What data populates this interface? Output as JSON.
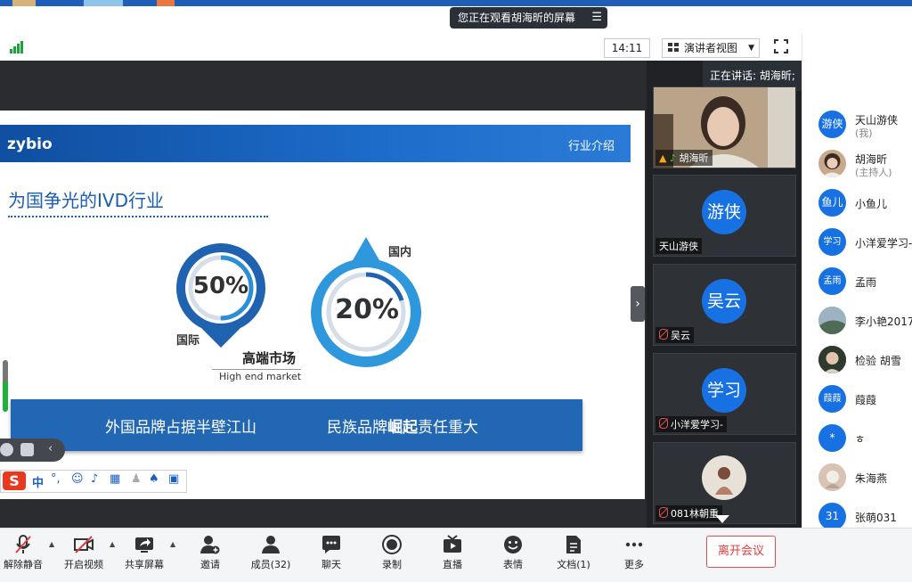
{
  "banner": {
    "watching_text": "您正在观看胡海昕的屏幕"
  },
  "toolbar": {
    "time": "14:11",
    "view_mode_label": "演讲者视图"
  },
  "speaking": {
    "label": "正在讲话: 胡海昕;"
  },
  "slide": {
    "logo_text": "zybio",
    "header_right": "行业介绍",
    "heading": "为国争光的IVD行业",
    "stat_international": {
      "value": "50%",
      "label": "国际",
      "fraction": 0.5
    },
    "stat_domestic": {
      "value": "20%",
      "label": "国内",
      "fraction": 0.2
    },
    "market_title": "高端市场",
    "market_subtitle": "High end market",
    "banner_left": "外国品牌占据半壁江山",
    "banner_right_prefix": "民族品牌",
    "banner_right_bold": "崛起",
    "banner_right_suffix": "责任重大"
  },
  "ime": {
    "logo": "S",
    "mode": "中"
  },
  "video_tiles": [
    {
      "name": "胡海昕",
      "avatar_text": ""
    },
    {
      "name": "天山游侠",
      "avatar_text": "游侠"
    },
    {
      "name": "吴云",
      "avatar_text": "吴云"
    },
    {
      "name": "小洋爱学习-",
      "avatar_text": "学习"
    },
    {
      "name": "081林朝重",
      "avatar_text": ""
    }
  ],
  "members": [
    {
      "avatar_text": "游侠",
      "name": "天山游侠",
      "role": "(我)"
    },
    {
      "avatar_text": "",
      "name": "胡海昕",
      "role": "(主持人)"
    },
    {
      "avatar_text": "鱼儿",
      "name": "小鱼儿",
      "role": ""
    },
    {
      "avatar_text": "学习",
      "name": "小洋爱学习-",
      "role": ""
    },
    {
      "avatar_text": "孟雨",
      "name": "孟雨",
      "role": ""
    },
    {
      "avatar_text": "",
      "name": "李小艳2017",
      "role": ""
    },
    {
      "avatar_text": "",
      "name": "检验 胡雪",
      "role": ""
    },
    {
      "avatar_text": "葭葭",
      "name": "葭葭",
      "role": ""
    },
    {
      "avatar_text": "*",
      "name": "ㅎ",
      "role": ""
    },
    {
      "avatar_text": "",
      "name": "朱海燕",
      "role": ""
    },
    {
      "avatar_text": "31",
      "name": "张萌031",
      "role": ""
    }
  ],
  "bottom_toolbar": {
    "unmute": "解除静音",
    "start_video": "开启视频",
    "share_screen": "共享屏幕",
    "invite": "邀请",
    "members": "成员(32)",
    "chat": "聊天",
    "record": "录制",
    "live": "直播",
    "reactions": "表情",
    "docs": "文档(1)",
    "more": "更多",
    "leave": "离开会议"
  },
  "colors": {
    "accent_blue": "#1871e3",
    "slide_blue": "#2167b4",
    "leave_red": "#e23c3c",
    "signal_green": "#1aa53a"
  }
}
